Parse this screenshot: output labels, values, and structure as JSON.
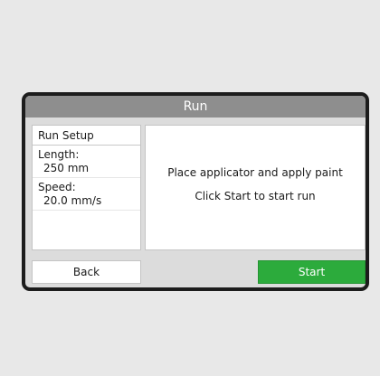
{
  "dialog": {
    "title": "Run",
    "setup": {
      "title": "Run Setup",
      "length_label": "Length:",
      "length_value": "250 mm",
      "speed_label": "Speed:",
      "speed_value": "20.0 mm/s"
    },
    "message": {
      "line1": "Place applicator and apply paint",
      "line2": "Click Start to start run"
    },
    "buttons": {
      "back": "Back",
      "start": "Start"
    }
  },
  "colors": {
    "titlebar": "#8e8e8e",
    "start_button": "#2cab3c",
    "dialog_border": "#1c1c1c"
  }
}
